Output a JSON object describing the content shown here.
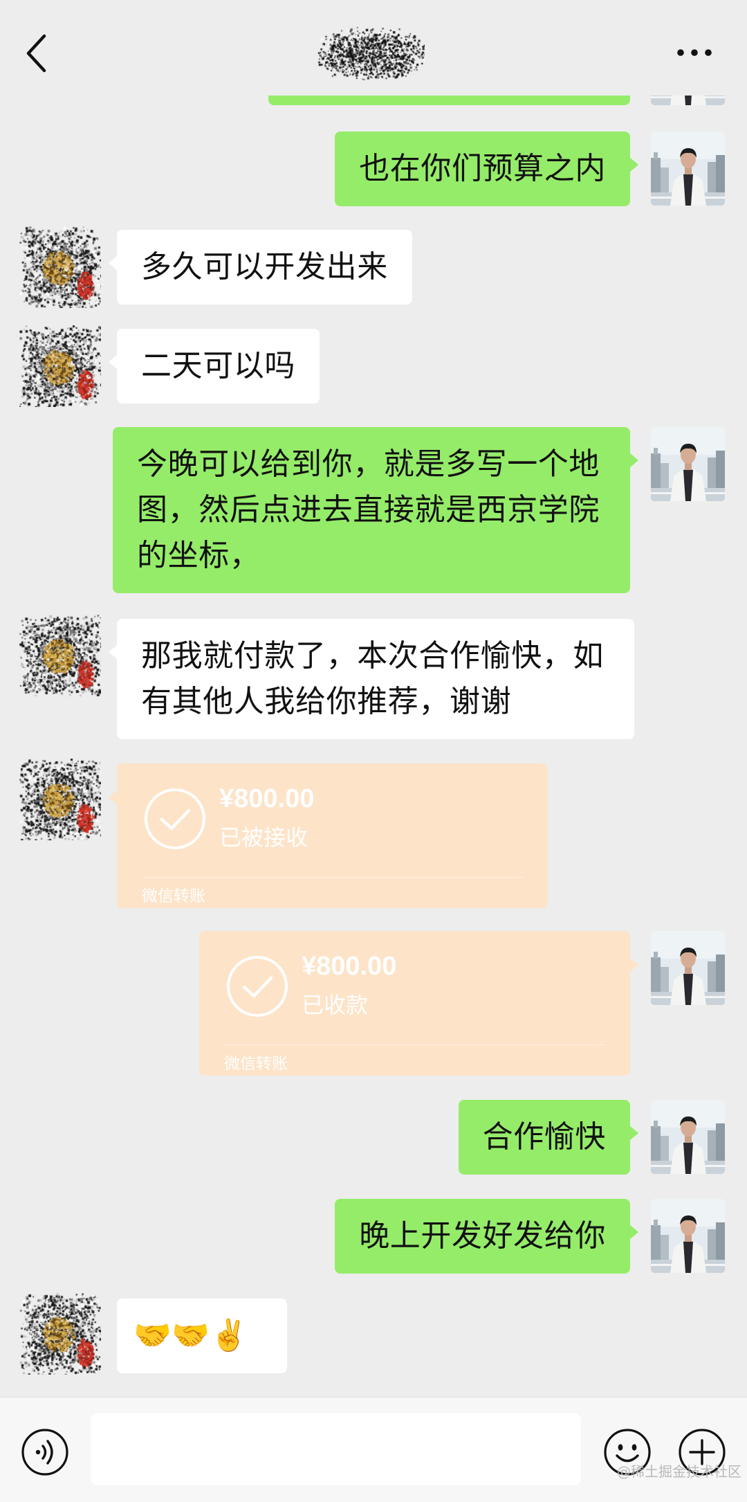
{
  "header": {
    "back_icon": "chevron-left-icon",
    "more_icon": "more-dots-icon"
  },
  "colors": {
    "background": "#ededed",
    "sent_bubble": "#95ec69",
    "received_bubble": "#ffffff",
    "transfer_bubble": "#fde3c8",
    "input_bar": "#f7f7f7"
  },
  "messages": [
    {
      "text": "也在你们预算之内"
    },
    {
      "text": "多久可以开发出来"
    },
    {
      "text": "二天可以吗"
    },
    {
      "text": "今晚可以给到你，就是多写一个地图，然后点进去直接就是西京学院的坐标，"
    },
    {
      "text": "那我就付款了，本次合作愉快，如有其他人我给你推荐，谢谢"
    },
    {
      "amount": "¥800.00",
      "status": "已被接收",
      "label": "微信转账"
    },
    {
      "amount": "¥800.00",
      "status": "已收款",
      "label": "微信转账"
    },
    {
      "text": "合作愉快"
    },
    {
      "text": "晚上开发好发给你"
    },
    {
      "text": "🤝🤝✌️"
    }
  ],
  "input_bar": {
    "voice_icon": "voice-icon",
    "emoji_icon": "emoji-icon",
    "plus_icon": "plus-icon"
  },
  "watermark": "@稀土掘金技术社区"
}
